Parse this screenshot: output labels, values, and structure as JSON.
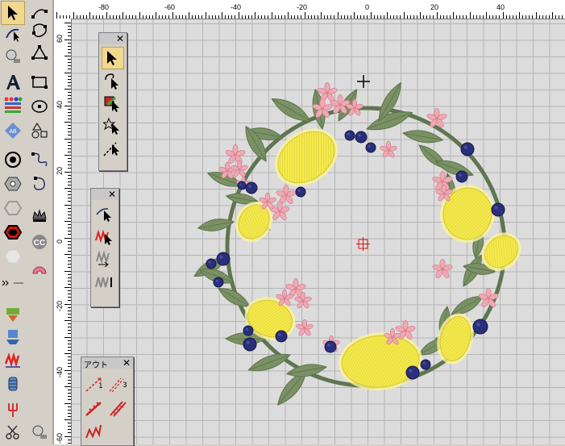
{
  "ruler": {
    "h_labels": [
      "-80",
      "-60",
      "-40",
      "-20",
      "0",
      "20",
      "40"
    ],
    "v_labels": [
      "60",
      "40",
      "20",
      "0",
      "-20",
      "-40",
      "-60"
    ]
  },
  "palettes": {
    "select_palette": {
      "close_glyph": "✕"
    },
    "stitch_palette": {
      "close_glyph": "✕"
    },
    "outline_palette": {
      "title": "アウト",
      "close_glyph": "✕",
      "num_1": "1",
      "num_3": "3"
    }
  },
  "colors": {
    "leaf": "#7d9466",
    "leaf_dark": "#5f7550",
    "lemon": "#f5e94a",
    "lemon_light": "#fbf49a",
    "flower": "#f1a8b4",
    "berry": "#2a2f7a",
    "selection": "#f0d890",
    "origin_marker": "#e01010"
  }
}
